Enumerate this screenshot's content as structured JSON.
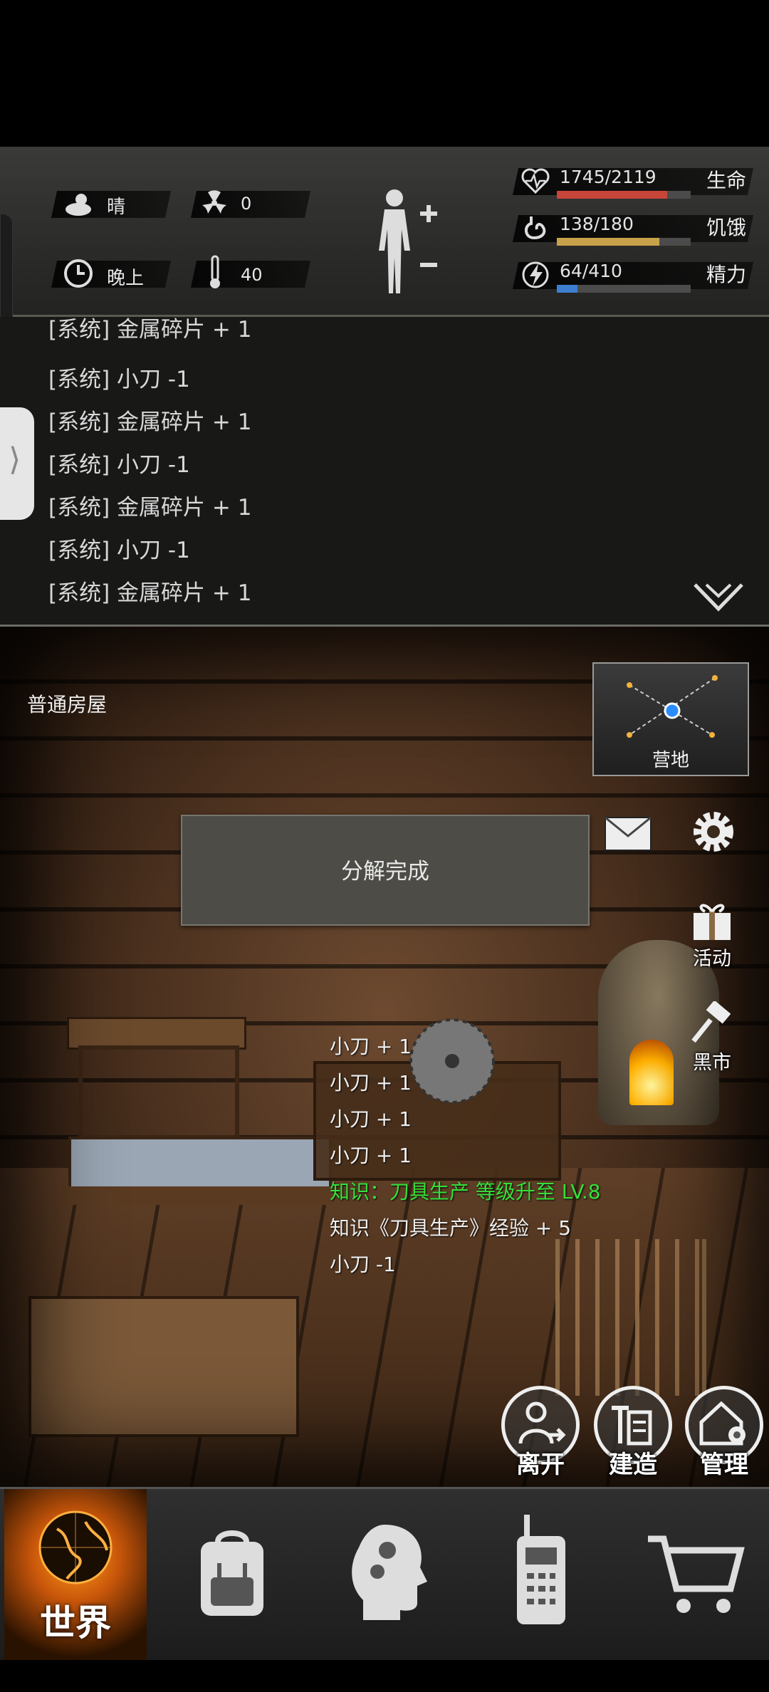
{
  "status": {
    "weather": "晴",
    "radiation": "0",
    "time_of_day": "晚上",
    "temperature": "40",
    "stats": [
      {
        "name": "生命",
        "value_text": "1745/2119",
        "fraction": 0.824,
        "color": "#c8453a",
        "icon": "heart-pulse-icon"
      },
      {
        "name": "饥饿",
        "value_text": "138/180",
        "fraction": 0.767,
        "color": "#c8a24a",
        "icon": "stomach-icon"
      },
      {
        "name": "精力",
        "value_text": "64/410",
        "fraction": 0.156,
        "color": "#3c7fd0",
        "icon": "lightning-icon"
      }
    ]
  },
  "log": {
    "lines": [
      "[系统] 金属碎片 + 1",
      "[系统] 小刀 -1",
      "[系统] 金属碎片 + 1",
      "[系统] 小刀 -1",
      "[系统] 金属碎片 + 1",
      "[系统] 小刀 -1",
      "[系统] 金属碎片 + 1"
    ]
  },
  "room": {
    "name": "普通房屋",
    "minimap_label": "营地",
    "toast": "分解完成",
    "side_buttons": {
      "activity": "活动",
      "black_market": "黑市"
    },
    "messages": [
      {
        "text": "小刀 + 1",
        "color": "#eeeeee"
      },
      {
        "text": "小刀 + 1",
        "color": "#eeeeee"
      },
      {
        "text": "小刀 + 1",
        "color": "#eeeeee"
      },
      {
        "text": "小刀 + 1",
        "color": "#eeeeee"
      },
      {
        "text": "知识：刀具生产 等级升至 LV.8",
        "color": "#35e03a"
      },
      {
        "text": "知识《刀具生产》经验 + 5",
        "color": "#eeeeee"
      },
      {
        "text": "小刀 -1",
        "color": "#eeeeee"
      }
    ],
    "actions": {
      "leave": "离开",
      "build": "建造",
      "manage": "管理"
    }
  },
  "nav": {
    "world": "世界"
  }
}
